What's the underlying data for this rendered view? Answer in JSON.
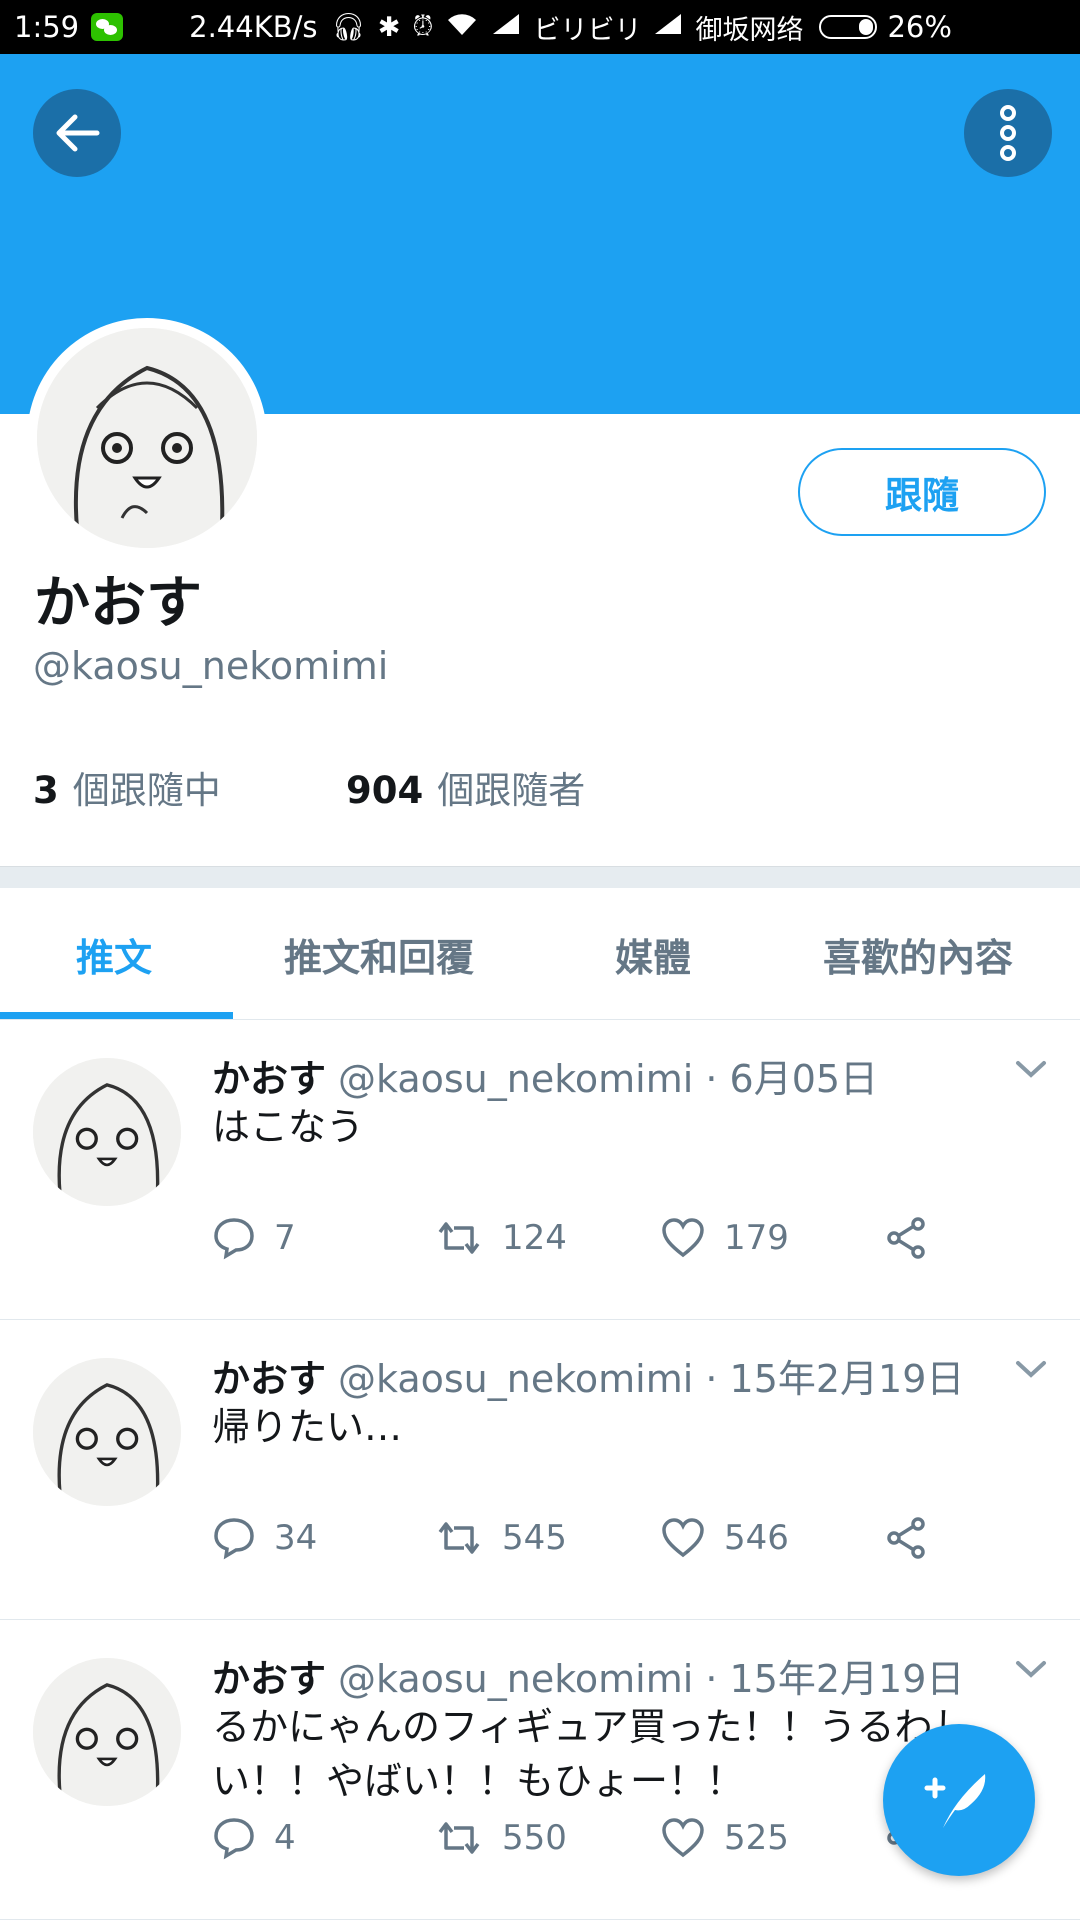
{
  "status_bar": {
    "time": "1:59",
    "speed": "2.44KB/s",
    "carrier1": "ビリビリ",
    "carrier2": "御坂网络",
    "battery": "26%"
  },
  "profile": {
    "display_name": "かおす",
    "handle": "@kaosu_nekomimi",
    "follow_label": "跟隨",
    "following_count": "3",
    "following_label": "個跟隨中",
    "followers_count": "904",
    "followers_label": "個跟隨者"
  },
  "tabs": [
    {
      "label": "推文"
    },
    {
      "label": "推文和回覆"
    },
    {
      "label": "媒體"
    },
    {
      "label": "喜歡的內容"
    }
  ],
  "tweets": [
    {
      "name": "かおす",
      "meta": "@kaosu_nekomimi · 6月05日",
      "text": "はこなう",
      "replies": "7",
      "retweets": "124",
      "likes": "179"
    },
    {
      "name": "かおす",
      "meta": "@kaosu_nekomimi · 15年2月19日",
      "text": "帰りたい…",
      "replies": "34",
      "retweets": "545",
      "likes": "546"
    },
    {
      "name": "かおす",
      "meta": "@kaosu_nekomimi · 15年2月19日",
      "text": "るかにゃんのフィギュア買った！！うるわしい！！やばい！！もひょー！！",
      "replies": "4",
      "retweets": "550",
      "likes": "525"
    }
  ],
  "colors": {
    "accent": "#1da1f2",
    "banner": "#1da1f2",
    "secondary_text": "#657786"
  },
  "icons": {
    "back": "arrow-left-icon",
    "more": "more-vertical-icon",
    "reply": "reply-icon",
    "retweet": "retweet-icon",
    "like": "heart-icon",
    "share": "share-icon",
    "compose": "compose-tweet-icon"
  }
}
